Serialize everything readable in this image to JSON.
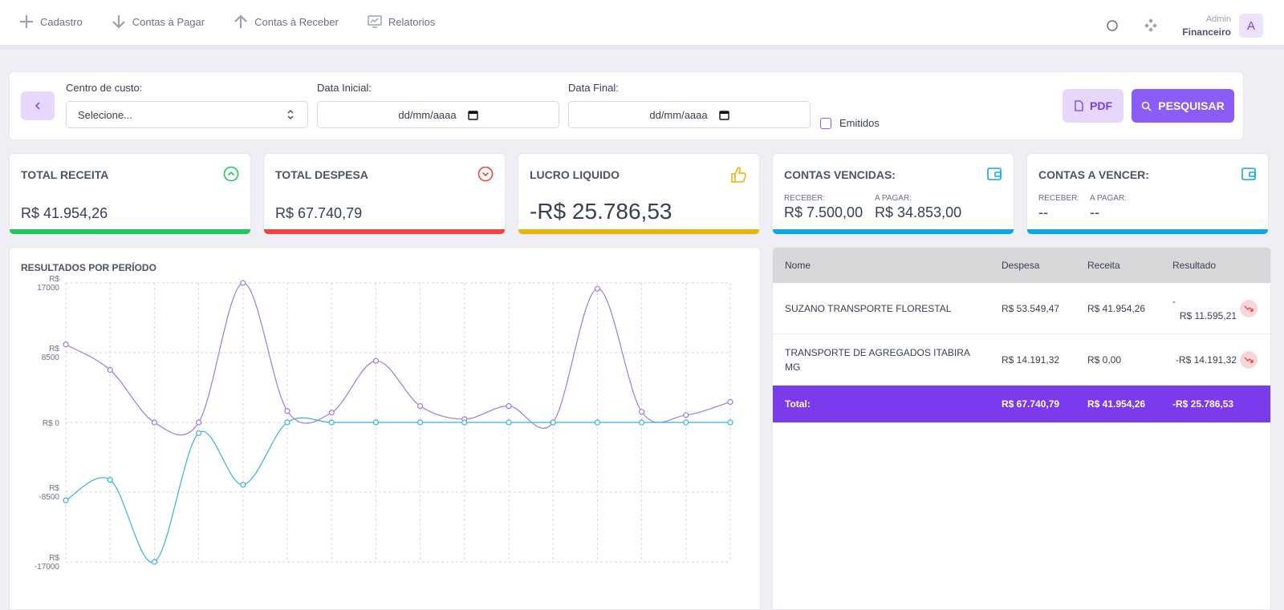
{
  "nav": [
    {
      "label": "Cadastro",
      "icon": "plus-icon"
    },
    {
      "label": "Contas à Pagar",
      "icon": "arrow-down-icon"
    },
    {
      "label": "Contas à Receber",
      "icon": "arrow-up-icon"
    },
    {
      "label": "Relatorios",
      "icon": "chart-monitor-icon"
    }
  ],
  "user": {
    "role": "Admin",
    "name": "Financeiro",
    "initial": "A"
  },
  "filters": {
    "centro_label": "Centro de custo:",
    "centro_value": "Selecione...",
    "data_inicial_label": "Data Inicial:",
    "data_inicial_value": "dd/mm/aaaa",
    "data_final_label": "Data Final:",
    "data_final_value": "dd/mm/aaaa",
    "emitidos_label": "Emitidos",
    "pdf_label": "PDF",
    "pesquisar_label": "PESQUISAR"
  },
  "cards": {
    "receita": {
      "title": "TOTAL RECEITA",
      "value": "R$ 41.954,26",
      "color": "#22c55e"
    },
    "despesa": {
      "title": "TOTAL DESPESA",
      "value": "R$ 67.740,79",
      "color": "#ef4444"
    },
    "lucro": {
      "title": "LUCRO LIQUIDO",
      "value": "-R$ 25.786,53",
      "color": "#eab308"
    },
    "vencidas": {
      "title": "CONTAS VENCIDAS:",
      "receber_label": "RECEBER:",
      "receber_value": "R$ 7.500,00",
      "pagar_label": "A PAGAR:",
      "pagar_value": "R$ 34.853,00",
      "color": "#0ea5e9"
    },
    "a_vencer": {
      "title": "CONTAS A VENCER:",
      "receber_label": "RECEBER:",
      "receber_value": "--",
      "pagar_label": "A PAGAR:",
      "pagar_value": "--",
      "color": "#0ea5e9"
    }
  },
  "chart": {
    "title": "RESULTADOS POR PERÍODO",
    "y_ticks": [
      {
        "label": "R$ 17000",
        "line1": "R$",
        "line2": "17000"
      },
      {
        "label": "R$ 8500",
        "line1": "R$",
        "line2": "8500"
      },
      {
        "label": "R$ 0",
        "line1": "R$ 0",
        "line2": ""
      },
      {
        "label": "R$ -8500",
        "line1": "R$",
        "line2": "-8500"
      },
      {
        "label": "R$ -17000",
        "line1": "R$",
        "line2": "-17000"
      }
    ]
  },
  "chart_data": {
    "type": "line",
    "title": "RESULTADOS POR PERÍODO",
    "ylim": [
      -17000,
      17000
    ],
    "grid": true,
    "x": [
      1,
      2,
      3,
      4,
      5,
      6,
      7,
      8,
      9,
      10,
      11,
      12,
      13,
      14,
      15,
      16
    ],
    "series": [
      {
        "color": "#9b7be0",
        "values": [
          9500,
          6400,
          0,
          0,
          17000,
          1400,
          1200,
          7500,
          2000,
          400,
          2000,
          0,
          16300,
          1300,
          900,
          2500
        ]
      },
      {
        "color": "#38b2d6",
        "values": [
          -9500,
          -7000,
          -17000,
          -1300,
          -7600,
          0,
          0,
          0,
          0,
          0,
          0,
          0,
          0,
          0,
          0,
          0
        ]
      }
    ]
  },
  "table": {
    "headers": {
      "nome": "Nome",
      "despesa": "Despesa",
      "receita": "Receita",
      "resultado": "Resultado"
    },
    "rows": [
      {
        "nome": "SUZANO TRANSPORTE FLORESTAL",
        "despesa": "R$ 53.549,47",
        "receita": "R$ 41.954,26",
        "resultado_sign": "-",
        "resultado": "R$ 11.595,21"
      },
      {
        "nome": "TRANSPORTE DE AGREGADOS ITABIRA MG",
        "despesa": "R$ 14.191,32",
        "receita": "R$ 0,00",
        "resultado_sign": "",
        "resultado": "-R$ 14.191,32"
      }
    ],
    "total": {
      "label": "Total:",
      "despesa": "R$ 67.740,79",
      "receita": "R$ 41.954,26",
      "resultado": "-R$ 25.786,53"
    }
  }
}
